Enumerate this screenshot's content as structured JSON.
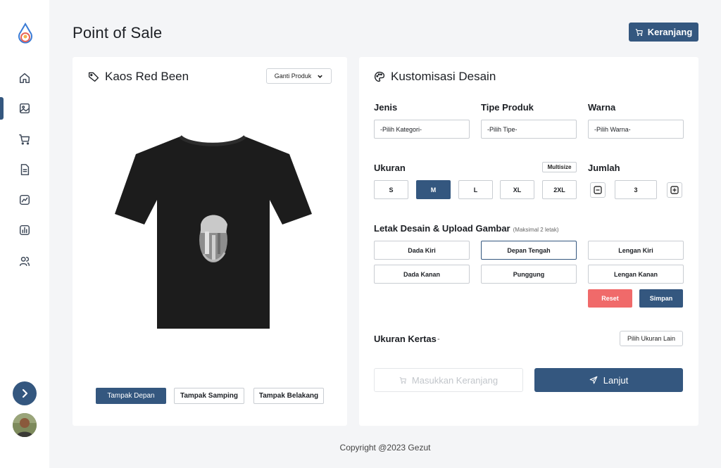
{
  "header": {
    "title": "Point of Sale",
    "cart_label": "Keranjang"
  },
  "sidebar": {
    "items": [
      {
        "icon": "home-icon"
      },
      {
        "icon": "image-icon",
        "active": true
      },
      {
        "icon": "cart-icon"
      },
      {
        "icon": "document-icon"
      },
      {
        "icon": "trend-icon"
      },
      {
        "icon": "bar-chart-icon"
      },
      {
        "icon": "users-icon"
      }
    ]
  },
  "product": {
    "name": "Kaos Red Been",
    "change_label": "Ganti Produk",
    "views": [
      "Tampak Depan",
      "Tampak Samping",
      "Tampak Belakang"
    ],
    "active_view": "Tampak Depan"
  },
  "customize": {
    "title": "Kustomisasi Desain",
    "jenis": {
      "label": "Jenis",
      "value": "-Pilih Kategori-"
    },
    "tipe": {
      "label": "Tipe Produk",
      "value": "-Pilih Tipe-"
    },
    "warna": {
      "label": "Warna",
      "value": "-Pilih Warna-"
    },
    "ukuran": {
      "label": "Ukuran",
      "multisize_label": "Multisize",
      "sizes": [
        "S",
        "M",
        "L",
        "XL",
        "2XL"
      ],
      "selected": "M"
    },
    "jumlah": {
      "label": "Jumlah",
      "value": "3"
    },
    "placement": {
      "label": "Letak Desain & Upload Gambar",
      "note": "(Maksimal 2 letak)",
      "options": [
        "Dada Kiri",
        "Depan Tengah",
        "Lengan Kiri",
        "Dada Kanan",
        "Punggung",
        "Lengan Kanan"
      ],
      "selected": "Depan Tengah"
    },
    "reset_label": "Reset",
    "save_label": "Simpan",
    "paper": {
      "label": "Ukuran Kertas",
      "value": "-",
      "button_label": "Pilih Ukuran Lain"
    },
    "add_to_cart_label": "Masukkan Keranjang",
    "next_label": "Lanjut"
  },
  "footer": {
    "text": "Copyright @2023 Gezut"
  },
  "colors": {
    "primary": "#34577f",
    "danger": "#f06a6a",
    "background": "#f4f5f7"
  }
}
